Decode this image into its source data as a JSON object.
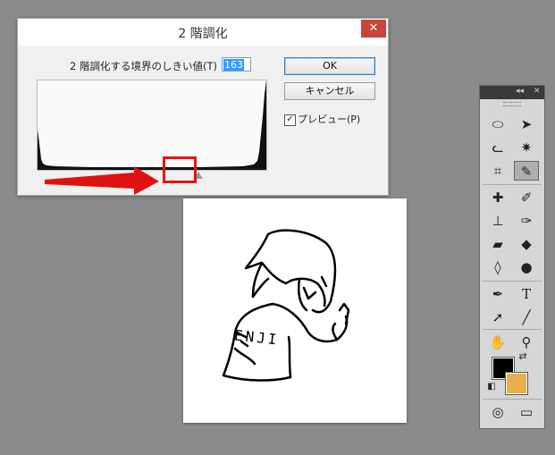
{
  "dialog": {
    "title": "2 階調化",
    "close": "✕",
    "threshold_label": "2 階調化する境界のしきい値(T) :",
    "threshold_value": "163",
    "ok_label": "OK",
    "cancel_label": "キャンセル",
    "preview_label": "プレビュー(P)",
    "preview_checked": "✓",
    "histogram_thumb_percent": 64
  },
  "toolbox": {
    "header_left": "◂◂",
    "header_right": "✕",
    "icons": [
      "marquee-icon",
      "move-icon",
      "lasso-icon",
      "magic-wand-icon",
      "crop-icon",
      "eyedropper-icon",
      "healing-brush-icon",
      "brush-icon",
      "clone-stamp-icon",
      "history-brush-icon",
      "eraser-icon",
      "paint-bucket-icon",
      "blur-icon",
      "dodge-icon",
      "pen-icon",
      "type-icon",
      "path-select-icon",
      "line-icon",
      "hand-icon",
      "zoom-icon",
      "quick-mask-icon",
      "screen-mode-icon"
    ],
    "fg_color": "#000000",
    "bg_color": "#e8b04d"
  },
  "annotation": {
    "arrow_color": "#e11111"
  },
  "artwork": {
    "shirt_text": "ENJI"
  }
}
